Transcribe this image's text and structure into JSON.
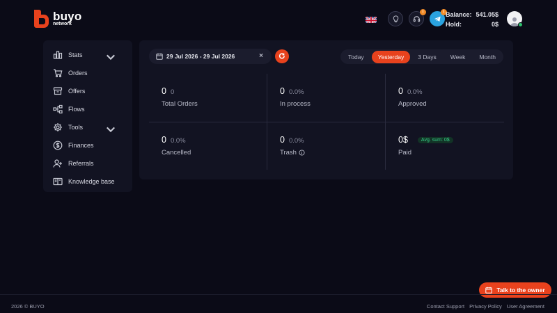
{
  "brand": {
    "name": "buyo",
    "sub": "network",
    "color": "#e8421d"
  },
  "header": {
    "language": "en-gb-flag",
    "notifications": {
      "support_badge": "!",
      "telegram_badge": "!"
    },
    "balance_label": "Balance:",
    "balance_value": "541.05$",
    "hold_label": "Hold:",
    "hold_value": "0$",
    "status": "online"
  },
  "sidebar": {
    "items": [
      {
        "label": "Stats",
        "icon": "bar-chart-icon",
        "expandable": true
      },
      {
        "label": "Orders",
        "icon": "cart-icon"
      },
      {
        "label": "Offers",
        "icon": "box-icon"
      },
      {
        "label": "Flows",
        "icon": "flow-icon"
      },
      {
        "label": "Tools",
        "icon": "gear-icon",
        "expandable": true
      },
      {
        "label": "Finances",
        "icon": "dollar-icon"
      },
      {
        "label": "Referrals",
        "icon": "user-add-icon"
      },
      {
        "label": "Knowledge base",
        "icon": "book-icon"
      }
    ]
  },
  "filters": {
    "date_range": "29 Jul 2026 - 29 Jul 2026",
    "clear": "×",
    "ranges": [
      "Today",
      "Yesterday",
      "3 Days",
      "Week",
      "Month"
    ],
    "active_range": "Yesterday"
  },
  "stats": [
    {
      "value": "0",
      "extra": "0",
      "label": "Total Orders"
    },
    {
      "value": "0",
      "extra": "0.0%",
      "label": "In process"
    },
    {
      "value": "0",
      "extra": "0.0%",
      "label": "Approved"
    },
    {
      "value": "0",
      "extra": "0.0%",
      "label": "Cancelled"
    },
    {
      "value": "0",
      "extra": "0.0%",
      "label": "Trash"
    },
    {
      "value": "0$",
      "extra": "Avg. sum: 0$",
      "label": "Paid"
    }
  ],
  "chat": {
    "label": "Talk to the owner"
  },
  "footer": {
    "copyright": "2026 © BUYO",
    "links": [
      "Contact Support",
      "Privacy Policy",
      "User Agreement"
    ]
  },
  "colors": {
    "accent": "#e8421d",
    "background": "#0b0b17",
    "panel": "#121322",
    "positive": "#39d08a"
  }
}
